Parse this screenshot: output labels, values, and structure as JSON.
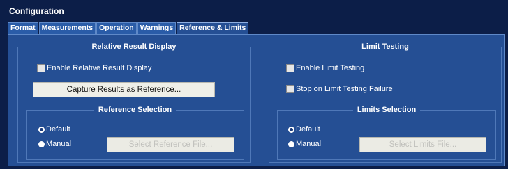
{
  "app": {
    "title": "Configuration"
  },
  "tabs": [
    {
      "label": "Format"
    },
    {
      "label": "Measurements"
    },
    {
      "label": "Operation"
    },
    {
      "label": "Warnings"
    },
    {
      "label": "Reference & Limits",
      "active": true
    }
  ],
  "relative": {
    "title": "Relative Result Display",
    "enable_label": "Enable Relative Result Display",
    "capture_button": "Capture Results as Reference...",
    "reference_selection": {
      "title": "Reference Selection",
      "default_label": "Default",
      "manual_label": "Manual",
      "selected": "Default",
      "select_file_button": "Select Reference File..."
    }
  },
  "limits": {
    "title": "Limit Testing",
    "enable_label": "Enable Limit Testing",
    "stop_label": "Stop on Limit Testing Failure",
    "limits_selection": {
      "title": "Limits Selection",
      "default_label": "Default",
      "manual_label": "Manual",
      "selected": "Default",
      "select_file_button": "Select Limits File..."
    }
  },
  "colors": {
    "background": "#0c1e48",
    "panel": "#254f94",
    "tab": "#2a5ca8",
    "button": "#efefe8"
  }
}
